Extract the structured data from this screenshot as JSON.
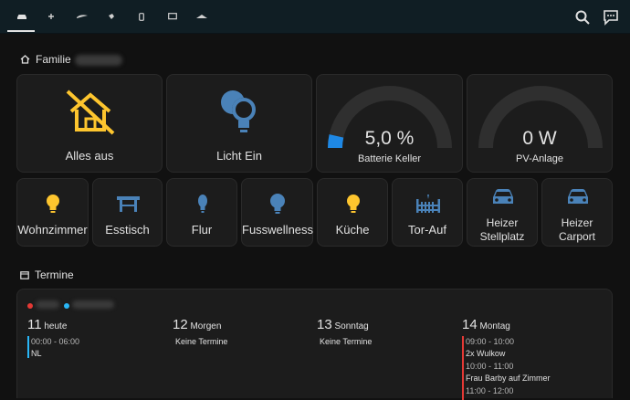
{
  "tabs": [
    {
      "icon": "car-icon"
    },
    {
      "icon": "plus-icon"
    },
    {
      "icon": "wave-icon"
    },
    {
      "icon": "bird-icon"
    },
    {
      "icon": "phone-icon"
    },
    {
      "icon": "monitor-icon"
    },
    {
      "icon": "roof-icon"
    }
  ],
  "header": {
    "search_icon": "search-icon",
    "assist_icon": "chat-icon"
  },
  "familie": {
    "title": "Familie",
    "alles_aus": "Alles aus",
    "licht_ein": "Licht Ein",
    "battery": {
      "value": "5,0 %",
      "label": "Batterie Keller",
      "level": 0.05
    },
    "pv": {
      "value": "0 W",
      "label": "PV-Anlage",
      "level": 0.0
    }
  },
  "rooms": [
    {
      "label": "Wohnzimmer",
      "icon": "lightbulb-icon",
      "color": "#fdc52e"
    },
    {
      "label": "Esstisch",
      "icon": "table-icon",
      "color": "#4a82b8"
    },
    {
      "label": "Flur",
      "icon": "lightbulb-icon",
      "color": "#4a82b8"
    },
    {
      "label": "Fusswellness",
      "icon": "lightbulb-icon",
      "color": "#4a82b8"
    },
    {
      "label": "Küche",
      "icon": "lightbulb-icon",
      "color": "#fdc52e"
    },
    {
      "label": "Tor-Auf",
      "icon": "gate-icon",
      "color": "#4a82b8"
    },
    {
      "label1": "Heizer",
      "label2": "Stellplatz",
      "icon": "car-icon",
      "color": "#4a82b8"
    },
    {
      "label1": "Heizer",
      "label2": "Carport",
      "icon": "car-icon",
      "color": "#4a82b8"
    }
  ],
  "termine": {
    "title": "Termine",
    "days": [
      {
        "num": "11",
        "name": "heute",
        "events": [
          {
            "time": "00:00 - 06:00",
            "title": "NL"
          }
        ]
      },
      {
        "num": "12",
        "name": "Morgen",
        "empty": "Keine Termine"
      },
      {
        "num": "13",
        "name": "Sonntag",
        "empty": "Keine Termine"
      },
      {
        "num": "14",
        "name": "Montag",
        "events": [
          {
            "time": "09:00 - 10:00",
            "title": "2x Wulkow"
          },
          {
            "time": "10:00 - 11:00",
            "title": "Frau Barby auf Zimmer"
          },
          {
            "time": "11:00 - 12:00",
            "title": ""
          }
        ]
      }
    ]
  },
  "colors": {
    "accent_yellow": "#fdc52e",
    "accent_blue": "#4a82b8",
    "gauge_blue": "#1e88e5"
  }
}
